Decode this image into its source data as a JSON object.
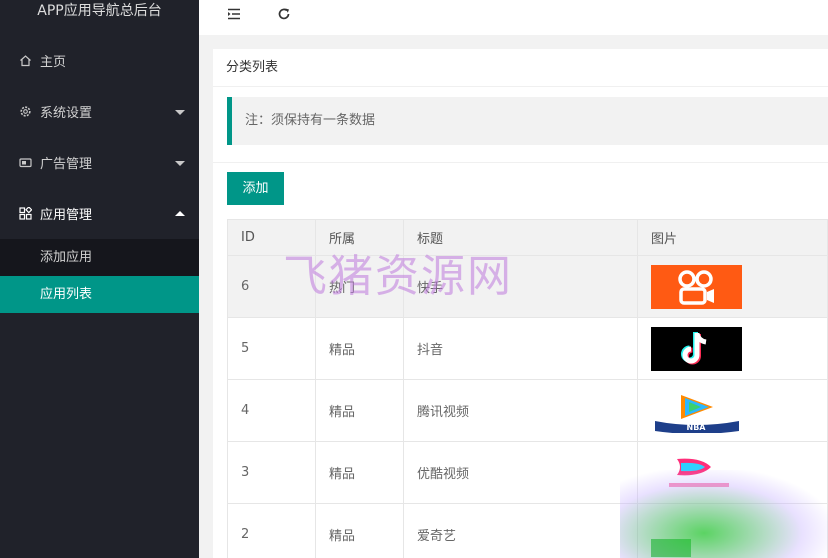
{
  "app": {
    "title": "APP应用导航总后台"
  },
  "sidebar": {
    "items": [
      {
        "label": "主页",
        "icon": "home-icon"
      },
      {
        "label": "系统设置",
        "icon": "gear-icon"
      },
      {
        "label": "广告管理",
        "icon": "ad-icon"
      },
      {
        "label": "应用管理",
        "icon": "apps-icon"
      }
    ],
    "subitems": [
      {
        "label": "添加应用"
      },
      {
        "label": "应用列表",
        "active": true
      }
    ]
  },
  "topbar": {
    "menu_icon": "menu-fold-icon",
    "refresh_icon": "refresh-icon"
  },
  "card": {
    "title": "分类列表",
    "note": "注：须保持有一条数据",
    "add_label": "添加"
  },
  "table": {
    "headers": [
      "ID",
      "所属",
      "标题",
      "图片"
    ],
    "rows": [
      {
        "id": "6",
        "category": "热门",
        "title": "快手",
        "image": "kuaishou-logo"
      },
      {
        "id": "5",
        "category": "精品",
        "title": "抖音",
        "image": "douyin-logo"
      },
      {
        "id": "4",
        "category": "精品",
        "title": "腾讯视频",
        "image": "tencent-video-logo"
      },
      {
        "id": "3",
        "category": "精品",
        "title": "优酷视频",
        "image": "youku-logo"
      },
      {
        "id": "2",
        "category": "精品",
        "title": "爱奇艺",
        "image": "iqiyi-logo"
      }
    ]
  },
  "watermark": "飞猪资源网",
  "colors": {
    "sidebar": "#20222a",
    "accent": "#009688",
    "note_bg": "#f2f2f2"
  }
}
